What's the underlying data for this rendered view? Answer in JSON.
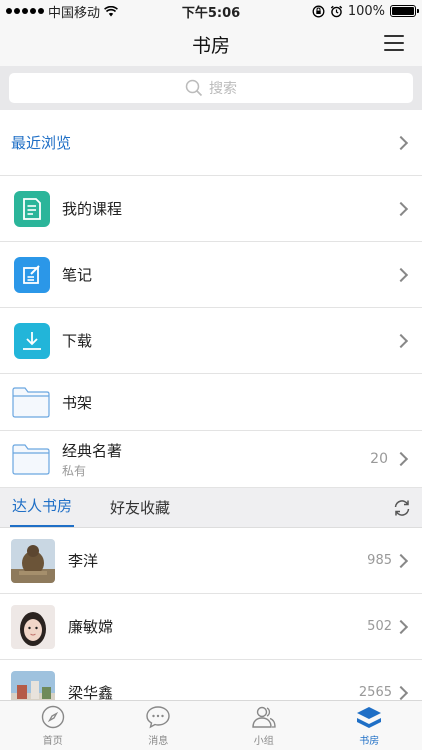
{
  "status_bar": {
    "carrier": "中国移动",
    "time": "下午5:06",
    "battery": "100%"
  },
  "nav": {
    "title": "书房"
  },
  "search": {
    "placeholder": "搜索"
  },
  "recent": {
    "label": "最近浏览"
  },
  "menu_rows": [
    {
      "label": "我的课程",
      "icon": "course-icon",
      "color": "#2bb59a"
    },
    {
      "label": "笔记",
      "icon": "note-icon",
      "color": "#2b97e8"
    },
    {
      "label": "下载",
      "icon": "download-icon",
      "color": "#22b5d9"
    }
  ],
  "folders": [
    {
      "label": "书架"
    },
    {
      "label": "经典名著",
      "sublabel": "私有",
      "count": "20"
    }
  ],
  "tabs": {
    "active": "达人书房",
    "other": "好友收藏"
  },
  "people": [
    {
      "name": "李洋",
      "count": "985"
    },
    {
      "name": "廉敏嫦",
      "count": "502"
    },
    {
      "name": "梁华鑫",
      "count": "2565"
    }
  ],
  "tab_bar": [
    {
      "label": "首页",
      "icon": "compass-icon"
    },
    {
      "label": "消息",
      "icon": "chat-icon"
    },
    {
      "label": "小组",
      "icon": "group-icon"
    },
    {
      "label": "书房",
      "icon": "study-icon",
      "active": true
    }
  ],
  "colors": {
    "accent": "#1f6fc6",
    "folder": "#6aa6e0"
  }
}
